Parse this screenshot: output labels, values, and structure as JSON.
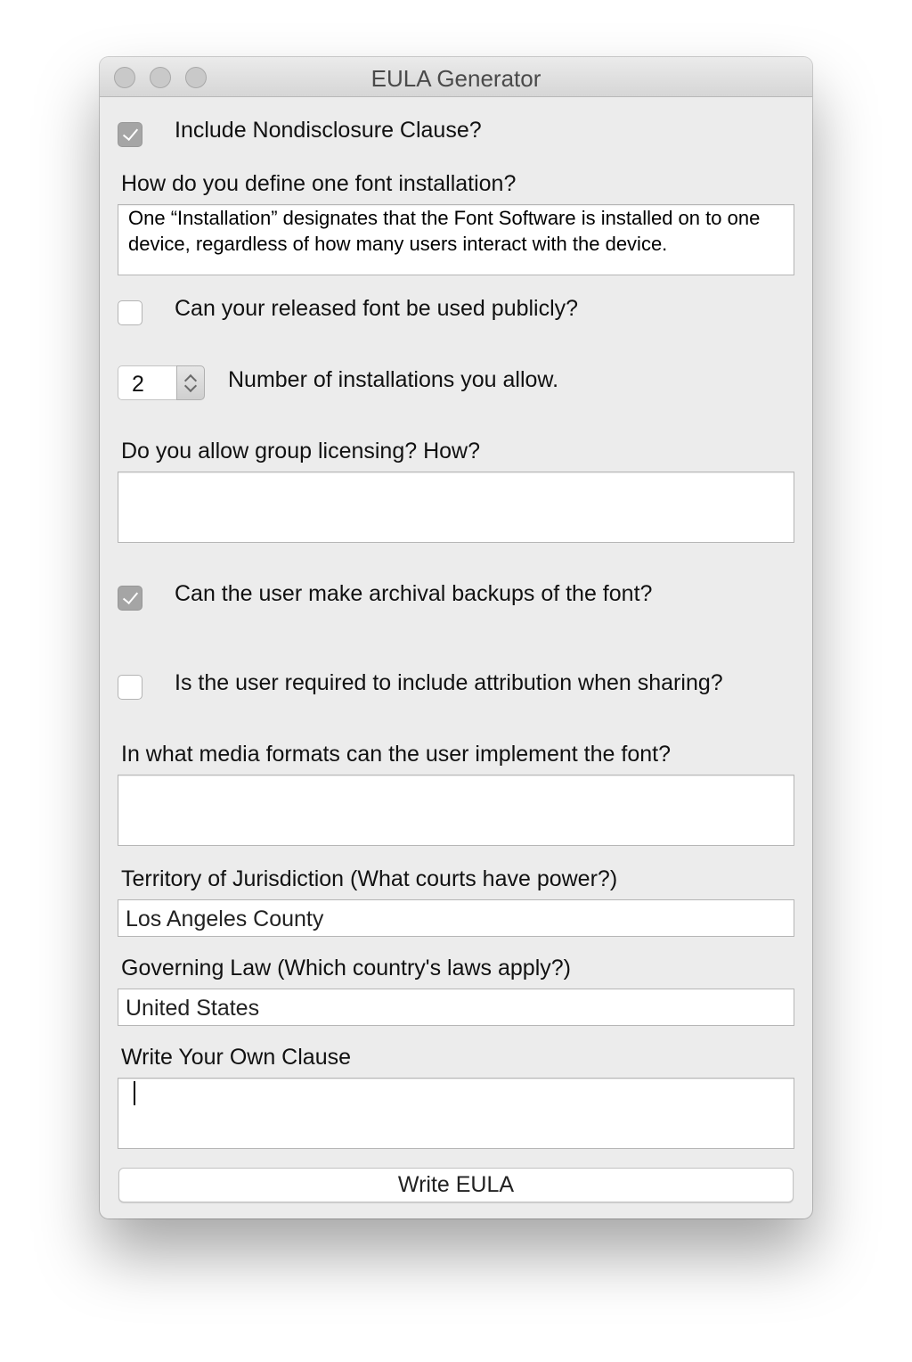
{
  "window": {
    "title": "EULA Generator"
  },
  "form": {
    "nondisclosure": {
      "label": "Include Nondisclosure Clause?",
      "checked": true
    },
    "installation_definition": {
      "label": "How do you define one font installation?",
      "value": "One “Installation” designates that the Font Software is installed on to one device, regardless of how many users interact with the device."
    },
    "public_use": {
      "label": "Can your released font be used publicly?",
      "checked": false
    },
    "installations": {
      "value": "2",
      "label": "Number of installations you allow."
    },
    "group_licensing": {
      "label": "Do you allow group licensing? How?",
      "value": ""
    },
    "archival_backups": {
      "label": "Can the user make archival backups of the font?",
      "checked": true
    },
    "attribution": {
      "label": "Is the user required to include attribution when sharing?",
      "checked": false
    },
    "media_formats": {
      "label": "In what media formats can the user implement the font?",
      "value": ""
    },
    "jurisdiction": {
      "label": "Territory of Jurisdiction (What courts have power?)",
      "value": "Los Angeles County"
    },
    "governing_law": {
      "label": "Governing Law (Which country's laws apply?)",
      "value": "United States"
    },
    "own_clause": {
      "label": "Write Your Own Clause",
      "value": ""
    },
    "submit_label": "Write EULA"
  }
}
